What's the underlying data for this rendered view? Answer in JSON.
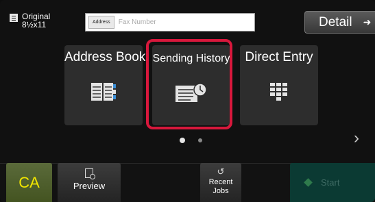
{
  "header": {
    "original_label": "Original",
    "original_size": "8½x11",
    "address_button_label": "Address",
    "fax_placeholder": "Fax Number",
    "detail_label": "Detail",
    "detail_arrow": "➜"
  },
  "tiles": [
    {
      "label": "Address Book",
      "icon": "address-book-icon"
    },
    {
      "label": "Sending History",
      "icon": "sending-history-icon",
      "highlighted": true
    },
    {
      "label": "Direct Entry",
      "icon": "keypad-icon"
    }
  ],
  "pagination": {
    "pages": 2,
    "current": 1,
    "next_arrow": "›"
  },
  "bottom_bar": {
    "ca_label": "CA",
    "preview_label": "Preview",
    "recent_jobs_label": "Recent Jobs",
    "start_label": "Start"
  },
  "colors": {
    "highlight": "#d8183c",
    "ca_text": "#f2e600",
    "start_bg": "#0b3a33"
  }
}
